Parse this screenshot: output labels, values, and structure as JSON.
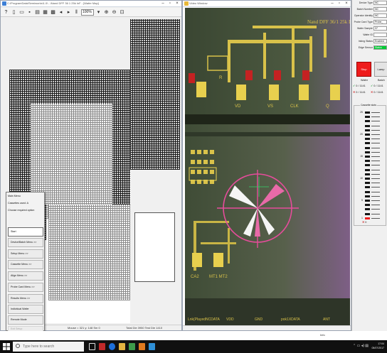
{
  "left_window": {
    "title": "C:\\ProgramData\\Semiworks\\1.0\\...\\Nand DFF 36 1 25k InF - [Wafer Map]",
    "zoom": "100%",
    "status": {
      "mouse": "Mouse = 321 y: 148   Sm 0",
      "totals": "Total Die 3950 Test Die 1410"
    }
  },
  "context_menu": {
    "header_items": [
      "Main Menu",
      "Cassettes used: A",
      "Choose required option"
    ],
    "buttons": [
      {
        "label": "Start"
      },
      {
        "label": "Device/Batch Menu >>"
      },
      {
        "label": "Setup Menu >>"
      },
      {
        "label": "Cassette Menu >>"
      },
      {
        "label": "Align Menu >>"
      },
      {
        "label": "Probe Card Menu >>"
      },
      {
        "label": "Results Menu >>"
      },
      {
        "label": "Individual Wafer"
      },
      {
        "label": "Remote Mode"
      },
      {
        "label": "Exit Setup"
      }
    ]
  },
  "right_window": {
    "title": "Video Window",
    "bottom_label": "Info",
    "chip_labels": {
      "top_text": "Nand DFF 36/1 25k InF",
      "pad_labels": [
        "VD",
        "VS",
        "CLK",
        "Q"
      ],
      "pad_label_r": "R",
      "lower_pads": [
        "CA2",
        "MT1 MT2"
      ],
      "bottom_text": [
        "Lnk(PlayedNCDATA",
        "VDD",
        "GND",
        "pok1XDATA",
        "ANT"
      ]
    }
  },
  "side_panel": {
    "fields": [
      {
        "label": "Device Type",
        "value": "NC"
      },
      {
        "label": "Batch Number",
        "value": "NC"
      },
      {
        "label": "Operator Identity",
        "value": "NC"
      },
      {
        "label": "Probe Card Type",
        "value": "Probe_"
      },
      {
        "label": "Wafer Sample",
        "value": "37"
      },
      {
        "label": "Wafer ID",
        "value": ""
      },
      {
        "label": "Inking Status",
        "value": "Enabled"
      },
      {
        "label": "Edge Sensor",
        "value": "Status"
      }
    ],
    "stop_label": "Stop",
    "lamp_label": "Lamp",
    "wafer_header": "Wafer",
    "batch_header": "Batch",
    "wafer_pass": "0 / 1141",
    "wafer_fail": "0 / 1141",
    "batch_pass": "0 / 1141",
    "batch_fail": "0 / 1141",
    "cassette_header": "Cassette slots",
    "slot_numbers": [
      "25",
      "20",
      "15",
      "10",
      "5",
      "1"
    ],
    "bottom_value": "0"
  },
  "taskbar": {
    "search_placeholder": "Type here to search",
    "time": "17:04",
    "date": "05/07/2017"
  },
  "colors": {
    "stop_red": "#ee1c1c",
    "edge_sensor_green": "#00cc33",
    "pass_green": "#1f9d3a",
    "fail_red": "#cc1f1f",
    "chip_green": "#3e4a32",
    "pad_yellow": "#e8d04e",
    "target_pink": "#e64c9b"
  }
}
